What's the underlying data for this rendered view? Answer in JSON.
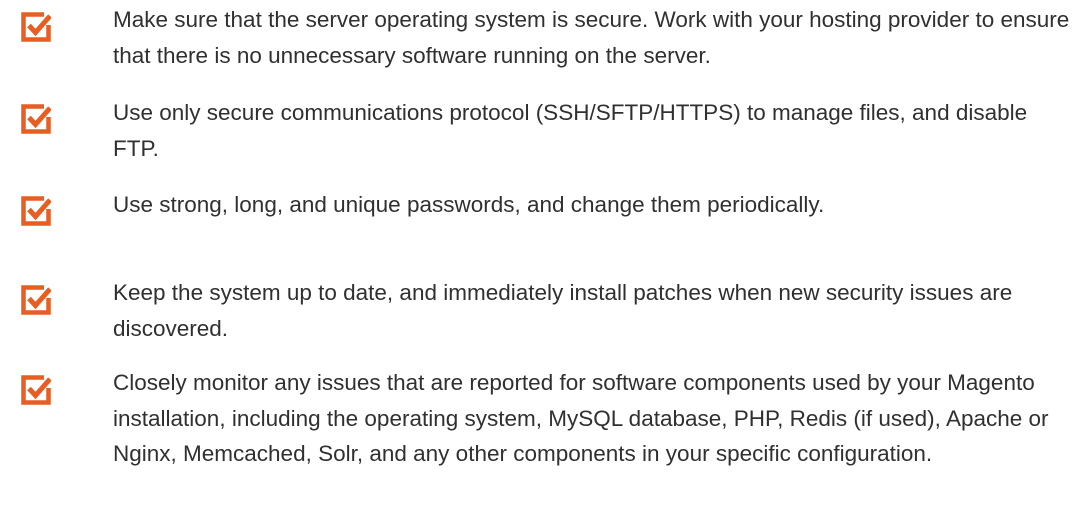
{
  "checklist": {
    "accent_color": "#e85d22",
    "icon": "checkbox-checked-icon",
    "items": [
      {
        "text": "Make sure that the server operating system is secure. Work with your hosting provider to ensure that there is no unnecessary software running on the server."
      },
      {
        "text": "Use only secure communications protocol (SSH/SFTP/HTTPS) to manage files, and disable FTP."
      },
      {
        "text": "Use strong, long, and unique passwords, and change them periodically."
      },
      {
        "text": "Keep the system up to date, and immediately install patches when new security issues are discovered."
      },
      {
        "text": "Closely monitor any issues that are reported for software components used by your Magento installation, including the operating system, MySQL database, PHP, Redis (if used), Apache or Nginx, Memcached, Solr, and any other components in your specific configuration."
      }
    ]
  }
}
